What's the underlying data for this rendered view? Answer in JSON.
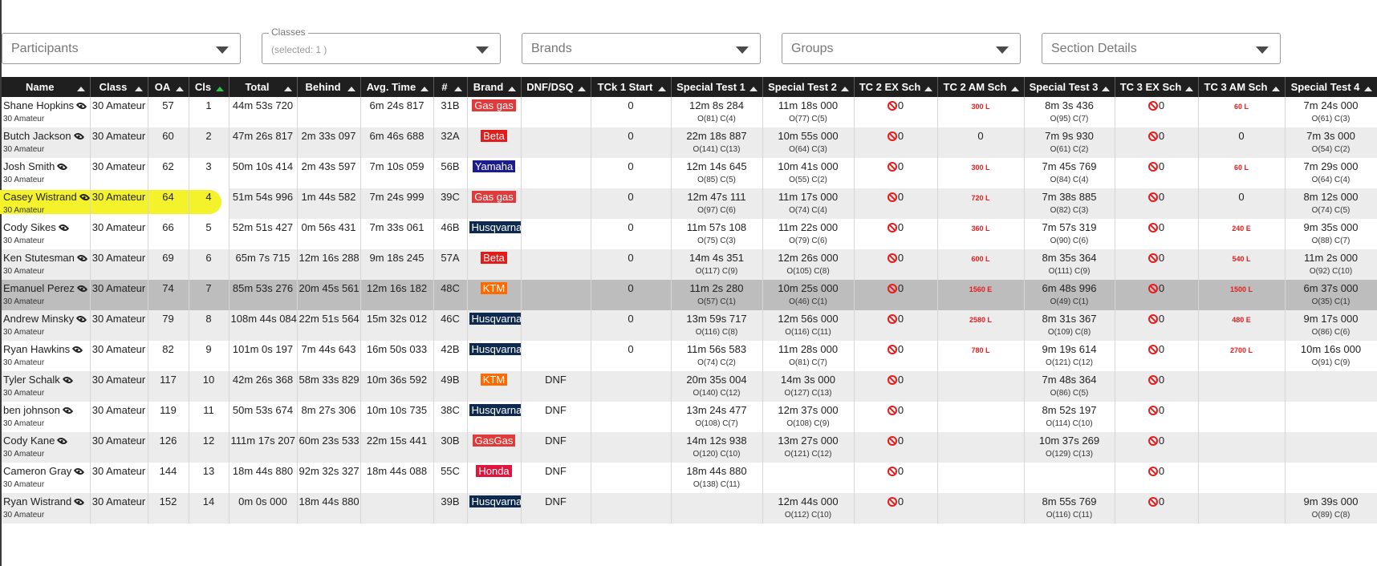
{
  "filters": [
    {
      "name": "participants",
      "label": "Participants"
    },
    {
      "name": "classes",
      "legend": "Classes",
      "selected": "(selected: 1 )"
    },
    {
      "name": "brands",
      "label": "Brands"
    },
    {
      "name": "groups",
      "label": "Groups"
    },
    {
      "name": "section-details",
      "label": "Section Details"
    }
  ],
  "columns": [
    "Name",
    "Class",
    "OA",
    "Cls",
    "Total",
    "Behind",
    "Avg. Time",
    "#",
    "Brand",
    "DNF/DSQ",
    "TCk 1 Start",
    "Special Test 1",
    "Special Test 2",
    "TC 2 EX Sch",
    "TC 2 AM Sch",
    "Special Test 3",
    "TC 3 EX Sch",
    "TC 3 AM Sch",
    "Special Test 4"
  ],
  "active_sort_column": "Cls",
  "colors": {
    "header_bg": "#1f1f1f",
    "sort_active": "#2ec44a",
    "penalty": "#e41e1e",
    "highlight": "#f4f22a"
  },
  "brand_colors": {
    "Gas gas": "#e03a3a",
    "GasGas": "#e03a3a",
    "Beta": "#e21b1b",
    "Yamaha": "#1b1d8f",
    "Husqvarna": "#0e2a4e",
    "KTM": "#ff6a00",
    "Honda": "#e0143c"
  },
  "rows": [
    {
      "name": "Shane Hopkins",
      "sub": "30 Amateur",
      "class": "30 Amateur",
      "oa": "57",
      "cls": "1",
      "total": "44m 53s 720",
      "behind": "",
      "avg": "6m 24s 817",
      "num": "31B",
      "brand": "Gas gas",
      "dnf": "",
      "tck1": "0",
      "st1": "12m 8s 284",
      "st1s": "O(81) C(4)",
      "st2": "11m 18s 000",
      "st2s": "O(77) C(5)",
      "tc2ex": "0",
      "tc2am": "300 L",
      "st3": "8m 3s 436",
      "st3s": "O(95) C(7)",
      "tc3ex": "0",
      "tc3am": "60 L",
      "st4": "7m 24s 000",
      "st4s": "O(61) C(3)"
    },
    {
      "name": "Butch Jackson",
      "sub": "30 Amateur",
      "class": "30 Amateur",
      "oa": "60",
      "cls": "2",
      "total": "47m 26s 817",
      "behind": "2m 33s 097",
      "avg": "6m 46s 688",
      "num": "32A",
      "brand": "Beta",
      "dnf": "",
      "tck1": "0",
      "st1": "22m 18s 887",
      "st1s": "O(141) C(13)",
      "st2": "10m 55s 000",
      "st2s": "O(64) C(3)",
      "tc2ex": "0",
      "tc2am": "0",
      "st3": "7m 9s 930",
      "st3s": "O(61) C(2)",
      "tc3ex": "0",
      "tc3am": "0",
      "st4": "7m 3s 000",
      "st4s": "O(54) C(2)"
    },
    {
      "name": "Josh Smith",
      "sub": "30 Amateur",
      "class": "30 Amateur",
      "oa": "62",
      "cls": "3",
      "total": "50m 10s 414",
      "behind": "2m 43s 597",
      "avg": "7m 10s 059",
      "num": "56B",
      "brand": "Yamaha",
      "dnf": "",
      "tck1": "0",
      "st1": "12m 14s 645",
      "st1s": "O(85) C(5)",
      "st2": "10m 41s 000",
      "st2s": "O(55) C(2)",
      "tc2ex": "0",
      "tc2am": "300 L",
      "st3": "7m 45s 769",
      "st3s": "O(84) C(4)",
      "tc3ex": "0",
      "tc3am": "60 L",
      "st4": "7m 29s 000",
      "st4s": "O(64) C(4)"
    },
    {
      "name": "Casey Wistrand",
      "sub": "30 Amateur",
      "class": "30 Amateur",
      "oa": "64",
      "cls": "4",
      "total": "51m 54s 996",
      "behind": "1m 44s 582",
      "avg": "7m 24s 999",
      "num": "39C",
      "brand": "Gas gas",
      "dnf": "",
      "tck1": "0",
      "st1": "12m 47s 111",
      "st1s": "O(97) C(6)",
      "st2": "11m 17s 000",
      "st2s": "O(74) C(4)",
      "tc2ex": "0",
      "tc2am": "720 L",
      "st3": "7m 38s 885",
      "st3s": "O(82) C(3)",
      "tc3ex": "0",
      "tc3am": "0",
      "st4": "8m 12s 000",
      "st4s": "O(74) C(5)"
    },
    {
      "name": "Cody Sikes",
      "sub": "30 Amateur",
      "class": "30 Amateur",
      "oa": "66",
      "cls": "5",
      "total": "52m 51s 427",
      "behind": "0m 56s 431",
      "avg": "7m 33s 061",
      "num": "46B",
      "brand": "Husqvarna",
      "dnf": "",
      "tck1": "0",
      "st1": "11m 57s 108",
      "st1s": "O(75) C(3)",
      "st2": "11m 22s 000",
      "st2s": "O(79) C(6)",
      "tc2ex": "0",
      "tc2am": "360 L",
      "st3": "7m 57s 319",
      "st3s": "O(90) C(6)",
      "tc3ex": "0",
      "tc3am": "240 E",
      "st4": "9m 35s 000",
      "st4s": "O(88) C(7)"
    },
    {
      "name": "Ken Stutesman",
      "sub": "30 Amateur",
      "class": "30 Amateur",
      "oa": "69",
      "cls": "6",
      "total": "65m 7s 715",
      "behind": "12m 16s 288",
      "avg": "9m 18s 245",
      "num": "57A",
      "brand": "Beta",
      "dnf": "",
      "tck1": "0",
      "st1": "14m 4s 351",
      "st1s": "O(117) C(9)",
      "st2": "12m 26s 000",
      "st2s": "O(105) C(8)",
      "tc2ex": "0",
      "tc2am": "600 L",
      "st3": "8m 35s 364",
      "st3s": "O(111) C(9)",
      "tc3ex": "0",
      "tc3am": "540 L",
      "st4": "11m 2s 000",
      "st4s": "O(92) C(10)"
    },
    {
      "name": "Emanuel Perez",
      "sub": "30 Amateur",
      "class": "30 Amateur",
      "oa": "74",
      "cls": "7",
      "total": "85m 53s 276",
      "behind": "20m 45s 561",
      "avg": "12m 16s 182",
      "num": "48C",
      "brand": "KTM",
      "dnf": "",
      "tck1": "0",
      "st1": "11m 2s 280",
      "st1s": "O(57) C(1)",
      "st2": "10m 25s 000",
      "st2s": "O(46) C(1)",
      "tc2ex": "0",
      "tc2am": "1560 E",
      "st3": "6m 48s 996",
      "st3s": "O(49) C(1)",
      "tc3ex": "0",
      "tc3am": "1500 L",
      "st4": "6m 37s 000",
      "st4s": "O(35) C(1)"
    },
    {
      "name": "Andrew Minsky",
      "sub": "30 Amateur",
      "class": "30 Amateur",
      "oa": "79",
      "cls": "8",
      "total": "108m 44s 084",
      "behind": "22m 51s 564",
      "avg": "15m 32s 012",
      "num": "46C",
      "brand": "Husqvarna",
      "dnf": "",
      "tck1": "0",
      "st1": "13m 59s 717",
      "st1s": "O(116) C(8)",
      "st2": "12m 56s 000",
      "st2s": "O(116) C(11)",
      "tc2ex": "0",
      "tc2am": "2580 L",
      "st3": "8m 31s 367",
      "st3s": "O(109) C(8)",
      "tc3ex": "0",
      "tc3am": "480 E",
      "st4": "9m 17s 000",
      "st4s": "O(86) C(6)"
    },
    {
      "name": "Ryan Hawkins",
      "sub": "30 Amateur",
      "class": "30 Amateur",
      "oa": "82",
      "cls": "9",
      "total": "101m 0s 197",
      "behind": "7m 44s 643",
      "avg": "16m 50s 033",
      "num": "42B",
      "brand": "Husqvarna",
      "dnf": "",
      "tck1": "0",
      "st1": "11m 56s 583",
      "st1s": "O(74) C(2)",
      "st2": "11m 28s 000",
      "st2s": "O(81) C(7)",
      "tc2ex": "0",
      "tc2am": "780 L",
      "st3": "9m 19s 614",
      "st3s": "O(121) C(12)",
      "tc3ex": "0",
      "tc3am": "2700 L",
      "st4": "10m 16s 000",
      "st4s": "O(91) C(9)"
    },
    {
      "name": "Tyler Schalk",
      "sub": "30 Amateur",
      "class": "30 Amateur",
      "oa": "117",
      "cls": "10",
      "total": "42m 26s 368",
      "behind": "58m 33s 829",
      "avg": "10m 36s 592",
      "num": "49B",
      "brand": "KTM",
      "dnf": "DNF",
      "tck1": "",
      "st1": "20m 35s 004",
      "st1s": "O(140) C(12)",
      "st2": "14m 3s 000",
      "st2s": "O(127) C(13)",
      "tc2ex": "0",
      "tc2am": "",
      "st3": "7m 48s 364",
      "st3s": "O(86) C(5)",
      "tc3ex": "0",
      "tc3am": "",
      "st4": "",
      "st4s": ""
    },
    {
      "name": "ben johnson",
      "sub": "30 Amateur",
      "class": "30 Amateur",
      "oa": "119",
      "cls": "11",
      "total": "50m 53s 674",
      "behind": "8m 27s 306",
      "avg": "10m 10s 735",
      "num": "38C",
      "brand": "Husqvarna",
      "dnf": "DNF",
      "tck1": "",
      "st1": "13m 24s 477",
      "st1s": "O(108) C(7)",
      "st2": "12m 37s 000",
      "st2s": "O(108) C(9)",
      "tc2ex": "0",
      "tc2am": "",
      "st3": "8m 52s 197",
      "st3s": "O(114) C(10)",
      "tc3ex": "0",
      "tc3am": "",
      "st4": "",
      "st4s": ""
    },
    {
      "name": "Cody Kane",
      "sub": "30 Amateur",
      "class": "30 Amateur",
      "oa": "126",
      "cls": "12",
      "total": "111m 17s 207",
      "behind": "60m 23s 533",
      "avg": "22m 15s 441",
      "num": "30B",
      "brand": "GasGas",
      "dnf": "DNF",
      "tck1": "",
      "st1": "14m 12s 938",
      "st1s": "O(120) C(10)",
      "st2": "13m 27s 000",
      "st2s": "O(121) C(12)",
      "tc2ex": "0",
      "tc2am": "",
      "st3": "10m 37s 269",
      "st3s": "O(129) C(13)",
      "tc3ex": "0",
      "tc3am": "",
      "st4": "",
      "st4s": ""
    },
    {
      "name": "Cameron Gray",
      "sub": "30 Amateur",
      "class": "30 Amateur",
      "oa": "144",
      "cls": "13",
      "total": "18m 44s 880",
      "behind": "92m 32s 327",
      "avg": "18m 44s 088",
      "num": "55C",
      "brand": "Honda",
      "dnf": "DNF",
      "tck1": "",
      "st1": "18m 44s 880",
      "st1s": "O(138) C(11)",
      "st2": "",
      "st2s": "",
      "tc2ex": "0",
      "tc2am": "",
      "st3": "",
      "st3s": "",
      "tc3ex": "0",
      "tc3am": "",
      "st4": "",
      "st4s": ""
    },
    {
      "name": "Ryan Wistrand",
      "sub": "30 Amateur",
      "class": "30 Amateur",
      "oa": "152",
      "cls": "14",
      "total": "0m 0s 000",
      "behind": "18m 44s 880",
      "avg": "",
      "num": "39B",
      "brand": "Husqvarna",
      "dnf": "DNF",
      "tck1": "",
      "st1": "",
      "st1s": "",
      "st2": "12m 44s 000",
      "st2s": "O(112) C(10)",
      "tc2ex": "0",
      "tc2am": "",
      "st3": "8m 55s 769",
      "st3s": "O(116) C(11)",
      "tc3ex": "0",
      "tc3am": "",
      "st4": "9m 39s 000",
      "st4s": "O(89) C(8)"
    }
  ]
}
